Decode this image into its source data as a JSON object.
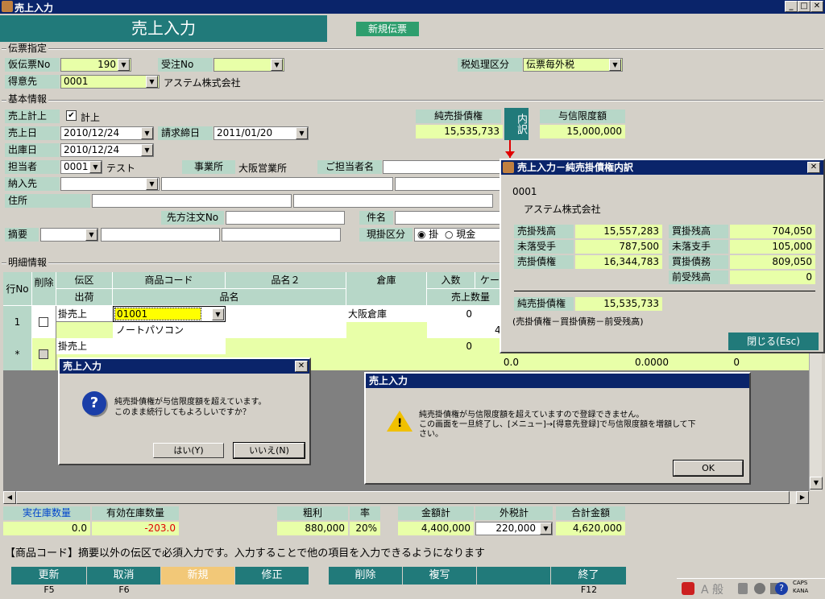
{
  "window": {
    "title": "売上入力"
  },
  "header": {
    "title": "売上入力",
    "new_slip_label": "新規伝票"
  },
  "slip": {
    "section_title": "伝票指定",
    "temp_no_label": "仮伝票No",
    "temp_no_value": "190",
    "order_no_label": "受注No",
    "order_no_value": "",
    "tax_label": "税処理区分",
    "tax_value": "伝票毎外税",
    "customer_label": "得意先",
    "customer_code": "0001",
    "customer_name": "アステム株式会社"
  },
  "basic": {
    "section_title": "基本情報",
    "sales_record_label": "売上計上",
    "sales_record_check": "計上",
    "sales_date_label": "売上日",
    "sales_date": "2010/12/24",
    "billing_close_label": "請求締日",
    "billing_close": "2011/01/20",
    "ship_date_label": "出庫日",
    "ship_date": "2010/12/24",
    "staff_label": "担当者",
    "staff_code": "0001",
    "staff_name": "テスト",
    "office_label": "事業所",
    "office_value": "大阪営業所",
    "contact_label": "ご担当者名",
    "delivery_label": "納入先",
    "address_label": "住所",
    "client_order_label": "先方注文No",
    "subject_label": "件名",
    "memo_label": "摘要",
    "pay_type_label": "現掛区分",
    "pay_option_1": "掛",
    "pay_option_2": "現金",
    "net_receivable_label": "純売掛債権",
    "net_receivable_value": "15,535,733",
    "detail_btn": "内訳",
    "credit_limit_label": "与信限度額",
    "credit_limit_value": "15,000,000"
  },
  "details": {
    "section_title": "明細情報",
    "headers": {
      "row_no": "行No",
      "delete": "削除",
      "slip_type": "伝区",
      "ship": "出荷",
      "product_code": "商品コード",
      "product_name2": "品名２",
      "product_name": "品名",
      "warehouse": "倉庫",
      "qty_per": "入数",
      "case": "ケー",
      "sales_qty": "売上数量"
    },
    "row1": {
      "no": "1",
      "type": "掛売上",
      "code": "01001",
      "warehouse": "大阪倉庫",
      "qty": "0",
      "name": "ノートパソコン",
      "sales_qty": "4"
    },
    "row2": {
      "no": "*",
      "type": "掛売上",
      "qty": "0",
      "val1": "0.0",
      "val2": "0.0000",
      "val3": "0"
    }
  },
  "summary": {
    "stock_label": "実在庫数量",
    "stock_value": "0.0",
    "avail_label": "有効在庫数量",
    "avail_value": "-203.0",
    "profit_label": "粗利",
    "profit_value": "880,000",
    "rate_label": "率",
    "rate_value": "20%",
    "amount_label": "金額計",
    "amount_value": "4,400,000",
    "tax_label": "外税計",
    "tax_value": "220,000",
    "total_label": "合計金額",
    "total_value": "4,620,000"
  },
  "status_text": "【商品コード】摘要以外の伝区で必須入力です。入力することで他の項目を入力できるようになります",
  "fkeys": [
    {
      "label": "更新",
      "key": "F5"
    },
    {
      "label": "取消",
      "key": "F6"
    },
    {
      "label": "新規",
      "key": ""
    },
    {
      "label": "修正",
      "key": ""
    },
    {
      "label": "",
      "key": ""
    },
    {
      "label": "削除",
      "key": ""
    },
    {
      "label": "複写",
      "key": ""
    },
    {
      "label": "",
      "key": ""
    },
    {
      "label": "終了",
      "key": "F12"
    }
  ],
  "breakdown": {
    "title": "売上入力－純売掛債権内訳",
    "code": "0001",
    "name": "アステム株式会社",
    "rows": [
      {
        "l1": "売掛残高",
        "v1": "15,557,283",
        "l2": "買掛残高",
        "v2": "704,050"
      },
      {
        "l1": "未落受手",
        "v1": "787,500",
        "l2": "未落支手",
        "v2": "105,000"
      },
      {
        "l1": "売掛債権",
        "v1": "16,344,783",
        "l2": "買掛債務",
        "v2": "809,050"
      }
    ],
    "advance_label": "前受残高",
    "advance_value": "0",
    "net_label": "純売掛債権",
    "net_value": "15,535,733",
    "formula": "(売掛債権－買掛債務－前受残高)",
    "close_btn": "閉じる(Esc)"
  },
  "dialog1": {
    "title": "売上入力",
    "message1": "純売掛債権が与信限度額を超えています。",
    "message2": "このまま続行してもよろしいですか？",
    "yes": "はい(Y)",
    "no": "いいえ(N)"
  },
  "dialog2": {
    "title": "売上入力",
    "message1": "純売掛債権が与信限度額を超えていますので登録できません。",
    "message2": "この画面を一旦終了し、[メニュー]→[得意先登録]で与信限度額を増額して下",
    "message3": "さい。",
    "ok": "OK"
  },
  "taskbar": {
    "caps": "CAPS",
    "kana": "KANA",
    "ime_text": "A 般"
  },
  "colors": {
    "title_bar": "#0a246a",
    "header": "#217a7a",
    "label": "#b7d7c8",
    "readonly": "#e8ffa8"
  }
}
